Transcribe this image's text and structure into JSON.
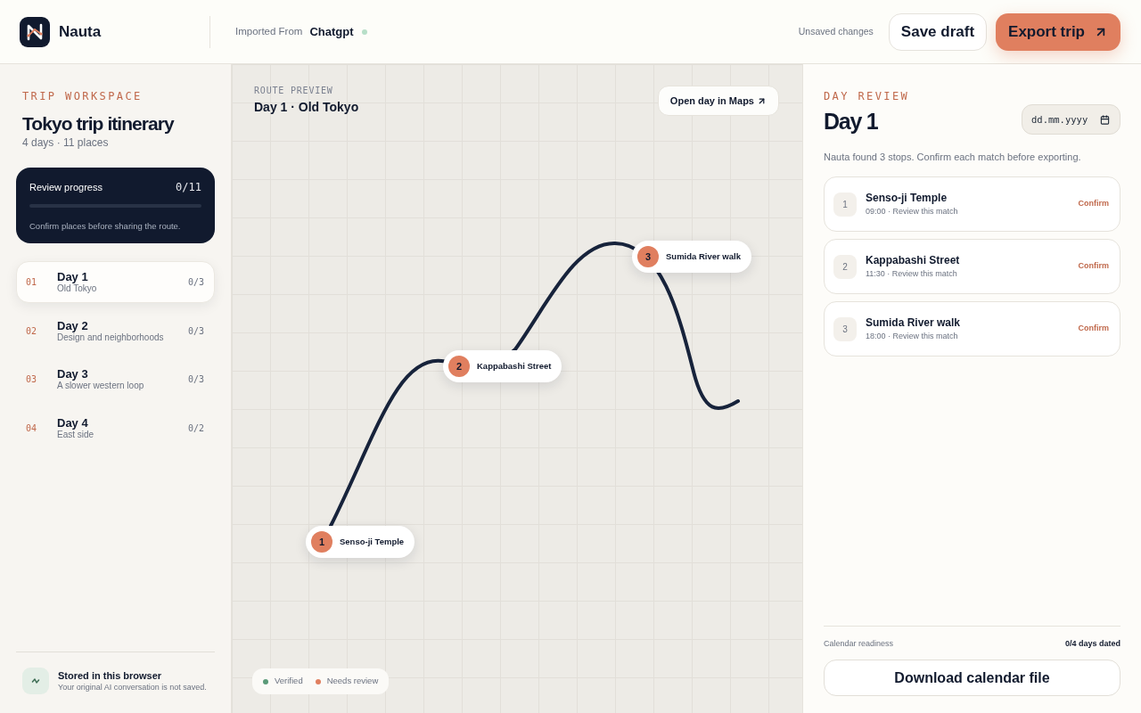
{
  "header": {
    "brand": "Nauta",
    "import_label": "Imported From",
    "import_source": "Chatgpt",
    "status": "Unsaved changes",
    "actions": [
      {
        "label": "Save draft",
        "kind": "secondary"
      },
      {
        "label": "Export trip",
        "kind": "primary"
      }
    ]
  },
  "sidebar": {
    "eyebrow": "TRIP WORKSPACE",
    "title": "Tokyo trip itinerary",
    "summary": "4 days · 11 places",
    "progress": {
      "label": "Review progress",
      "count": "0/11",
      "level": 0,
      "note": "Confirm places before sharing the route."
    },
    "days": [
      {
        "number": "01",
        "title": "Day 1",
        "subtitle": "Old Tokyo",
        "count": "0/3",
        "selected": true
      },
      {
        "number": "02",
        "title": "Day 2",
        "subtitle": "Design and neighborhoods",
        "count": "0/3",
        "selected": false
      },
      {
        "number": "03",
        "title": "Day 3",
        "subtitle": "A slower western loop",
        "count": "0/3",
        "selected": false
      },
      {
        "number": "04",
        "title": "Day 4",
        "subtitle": "East side",
        "count": "0/2",
        "selected": false
      }
    ],
    "storage": {
      "title": "Stored in this browser",
      "note": "Your original AI conversation is not saved."
    }
  },
  "map": {
    "eyebrow": "ROUTE PREVIEW",
    "title": "Day 1 · Old Tokyo",
    "action": "Open day in Maps",
    "stops": [
      {
        "number": "1",
        "name": "Senso-ji Temple"
      },
      {
        "number": "2",
        "name": "Kappabashi Street"
      },
      {
        "number": "3",
        "name": "Sumida River walk"
      }
    ],
    "legend": [
      {
        "label": "Verified",
        "color": "#5a9a78"
      },
      {
        "label": "Needs review",
        "color": "#e07f5f"
      }
    ]
  },
  "review": {
    "eyebrow": "DAY REVIEW",
    "title": "Day 1",
    "date": {
      "placeholder": "dd.mm.yyyy"
    },
    "intro": "Nauta found 3 stops. Confirm each match before exporting.",
    "stops": [
      {
        "number": "1",
        "name": "Senso-ji Temple",
        "meta": "09:00 · Review this match",
        "action": "Confirm"
      },
      {
        "number": "2",
        "name": "Kappabashi Street",
        "meta": "11:30 · Review this match",
        "action": "Confirm"
      },
      {
        "number": "3",
        "name": "Sumida River walk",
        "meta": "18:00 · Review this match",
        "action": "Confirm"
      }
    ],
    "readiness": {
      "label": "Calendar readiness",
      "value": "0/4 days dated"
    },
    "download": "Download calendar file"
  }
}
